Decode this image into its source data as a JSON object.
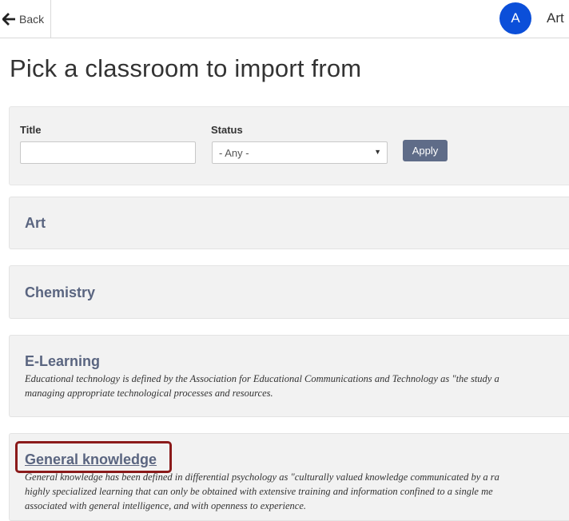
{
  "header": {
    "back_label": "Back",
    "avatar_initial": "A",
    "user_name": "Art"
  },
  "page": {
    "title": "Pick a classroom to import from"
  },
  "filters": {
    "title_label": "Title",
    "title_value": "",
    "status_label": "Status",
    "status_value": "- Any -",
    "apply_label": "Apply"
  },
  "classrooms": [
    {
      "title": "Art",
      "description": ""
    },
    {
      "title": "Chemistry",
      "description": ""
    },
    {
      "title": "E-Learning",
      "description_lines": [
        "Educational technology is defined by the Association for Educational Communications and Technology as \"the study a",
        "managing appropriate technological processes and resources."
      ]
    },
    {
      "title": "General knowledge",
      "description_lines": [
        "General knowledge has been defined in differential psychology as \"culturally valued knowledge communicated by a ra",
        "highly specialized learning that can only be obtained with extensive training and information confined to a single me",
        "associated with general intelligence, and with openness to experience."
      ]
    }
  ],
  "colors": {
    "avatar": "#0b4fd9",
    "apply_button": "#5f6c88",
    "card_title": "#5a6580",
    "highlight": "#8b1a1a"
  },
  "icons": {
    "back": "arrow-left-icon",
    "select_caret": "caret-down-icon"
  }
}
